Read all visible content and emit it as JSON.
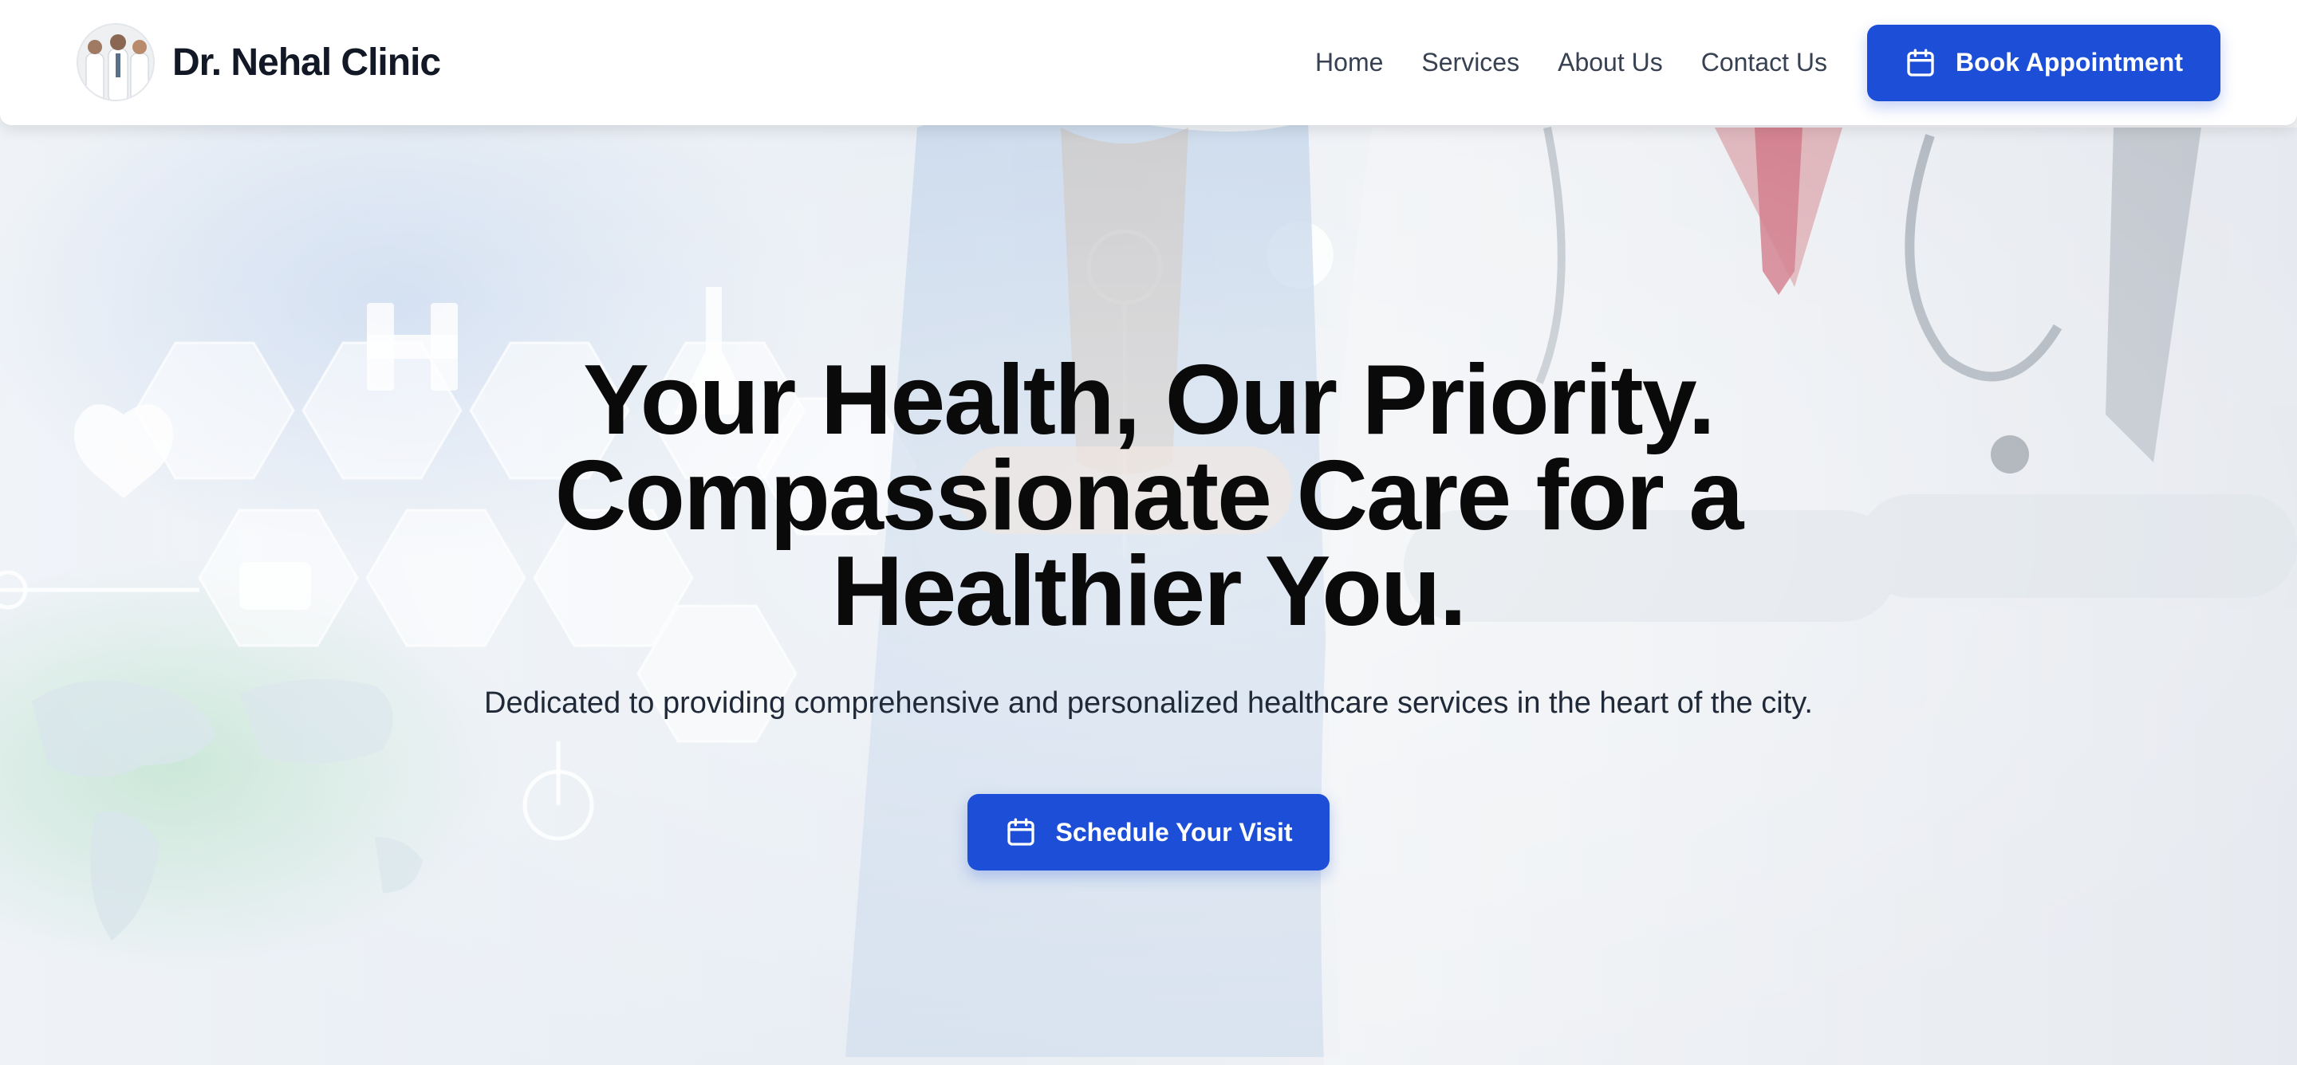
{
  "header": {
    "brand_name": "Dr. Nehal Clinic",
    "nav": {
      "home": "Home",
      "services": "Services",
      "about": "About Us",
      "contact": "Contact Us"
    },
    "book_button": {
      "label": "Book Appointment",
      "icon": "calendar-icon"
    }
  },
  "hero": {
    "title": "Your Health, Our Priority. Compassionate Care for a Healthier You.",
    "subtitle": "Dedicated to providing comprehensive and personalized healthcare services in the heart of the city.",
    "cta": {
      "label": "Schedule Your Visit",
      "icon": "calendar-icon"
    }
  },
  "colors": {
    "accent": "#1d4ed8",
    "text_dark": "#0a0a0a",
    "nav_text": "#374151",
    "header_bg": "#ffffff"
  }
}
